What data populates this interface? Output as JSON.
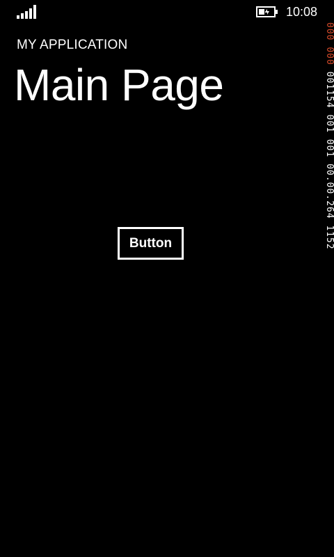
{
  "status_bar": {
    "signal_icon": "signal-strength-icon",
    "battery_icon": "battery-charging-icon",
    "time": "10:08"
  },
  "app": {
    "title": "MY APPLICATION",
    "page_title": "Main Page"
  },
  "main": {
    "button_label": "Button"
  },
  "frame_counter": {
    "red_1": "000",
    "red_2": "000",
    "white_1": "001",
    "white_2": "154",
    "white_3": "001",
    "white_4": "001",
    "white_5": "00",
    "white_6": "00",
    "white_7": "264",
    "white_8": "1152",
    "colors": {
      "red": "#d44a2a",
      "white": "#ffffff"
    }
  },
  "theme": {
    "background": "#000000",
    "foreground": "#ffffff"
  }
}
